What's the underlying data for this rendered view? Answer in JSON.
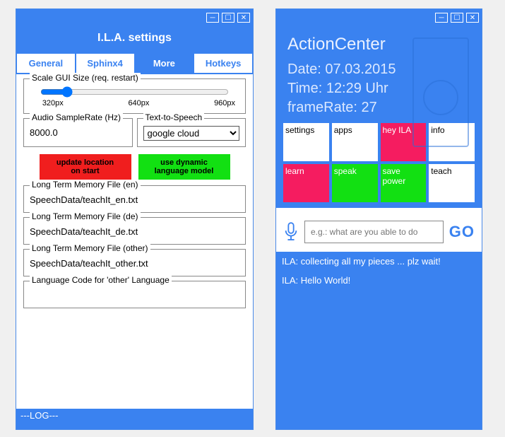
{
  "left": {
    "title": "I.L.A. settings",
    "tabs": {
      "general": "General",
      "sphinx4": "Sphinx4",
      "more": "More",
      "hotkeys": "Hotkeys"
    },
    "scale": {
      "legend": "Scale GUI Size (req. restart)",
      "t1": "320px",
      "t2": "640px",
      "t3": "960px"
    },
    "samplerate": {
      "legend": "Audio SampleRate (Hz)",
      "value": "8000.0"
    },
    "tts": {
      "legend": "Text-to-Speech",
      "value": "google cloud"
    },
    "btn_red_l1": "update location",
    "btn_red_l2": "on start",
    "btn_green_l1": "use dynamic",
    "btn_green_l2": "language model",
    "ltm_en": {
      "legend": "Long Term Memory File (en)",
      "value": "SpeechData/teachIt_en.txt"
    },
    "ltm_de": {
      "legend": "Long Term Memory File (de)",
      "value": "SpeechData/teachIt_de.txt"
    },
    "ltm_other": {
      "legend": "Long Term Memory File (other)",
      "value": "SpeechData/teachIt_other.txt"
    },
    "lang_code": {
      "legend": "Language Code for 'other' Language",
      "value": ""
    },
    "footer": "---LOG---"
  },
  "right": {
    "ac_title": "ActionCenter",
    "date": "Date: 07.03.2015",
    "time": "Time: 12:29 Uhr",
    "framerate": "frameRate: 27",
    "tiles": {
      "settings": "settings",
      "apps": "apps",
      "hey": "hey ILA",
      "info": "info",
      "learn": "learn",
      "speak": "speak",
      "save": "save power",
      "teach": "teach"
    },
    "input_placeholder": "e.g.: what are you able to do",
    "go": "GO",
    "log1": "ILA: collecting all my pieces ... plz wait!",
    "log2": "ILA: Hello World!"
  }
}
